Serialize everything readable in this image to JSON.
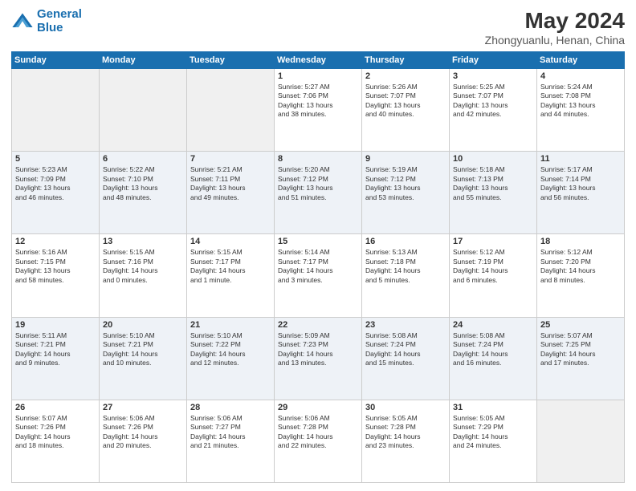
{
  "logo": {
    "line1": "General",
    "line2": "Blue"
  },
  "title": "May 2024",
  "subtitle": "Zhongyuanlu, Henan, China",
  "weekdays": [
    "Sunday",
    "Monday",
    "Tuesday",
    "Wednesday",
    "Thursday",
    "Friday",
    "Saturday"
  ],
  "weeks": [
    [
      {
        "day": "",
        "info": ""
      },
      {
        "day": "",
        "info": ""
      },
      {
        "day": "",
        "info": ""
      },
      {
        "day": "1",
        "info": "Sunrise: 5:27 AM\nSunset: 7:06 PM\nDaylight: 13 hours\nand 38 minutes."
      },
      {
        "day": "2",
        "info": "Sunrise: 5:26 AM\nSunset: 7:07 PM\nDaylight: 13 hours\nand 40 minutes."
      },
      {
        "day": "3",
        "info": "Sunrise: 5:25 AM\nSunset: 7:07 PM\nDaylight: 13 hours\nand 42 minutes."
      },
      {
        "day": "4",
        "info": "Sunrise: 5:24 AM\nSunset: 7:08 PM\nDaylight: 13 hours\nand 44 minutes."
      }
    ],
    [
      {
        "day": "5",
        "info": "Sunrise: 5:23 AM\nSunset: 7:09 PM\nDaylight: 13 hours\nand 46 minutes."
      },
      {
        "day": "6",
        "info": "Sunrise: 5:22 AM\nSunset: 7:10 PM\nDaylight: 13 hours\nand 48 minutes."
      },
      {
        "day": "7",
        "info": "Sunrise: 5:21 AM\nSunset: 7:11 PM\nDaylight: 13 hours\nand 49 minutes."
      },
      {
        "day": "8",
        "info": "Sunrise: 5:20 AM\nSunset: 7:12 PM\nDaylight: 13 hours\nand 51 minutes."
      },
      {
        "day": "9",
        "info": "Sunrise: 5:19 AM\nSunset: 7:12 PM\nDaylight: 13 hours\nand 53 minutes."
      },
      {
        "day": "10",
        "info": "Sunrise: 5:18 AM\nSunset: 7:13 PM\nDaylight: 13 hours\nand 55 minutes."
      },
      {
        "day": "11",
        "info": "Sunrise: 5:17 AM\nSunset: 7:14 PM\nDaylight: 13 hours\nand 56 minutes."
      }
    ],
    [
      {
        "day": "12",
        "info": "Sunrise: 5:16 AM\nSunset: 7:15 PM\nDaylight: 13 hours\nand 58 minutes."
      },
      {
        "day": "13",
        "info": "Sunrise: 5:15 AM\nSunset: 7:16 PM\nDaylight: 14 hours\nand 0 minutes."
      },
      {
        "day": "14",
        "info": "Sunrise: 5:15 AM\nSunset: 7:17 PM\nDaylight: 14 hours\nand 1 minute."
      },
      {
        "day": "15",
        "info": "Sunrise: 5:14 AM\nSunset: 7:17 PM\nDaylight: 14 hours\nand 3 minutes."
      },
      {
        "day": "16",
        "info": "Sunrise: 5:13 AM\nSunset: 7:18 PM\nDaylight: 14 hours\nand 5 minutes."
      },
      {
        "day": "17",
        "info": "Sunrise: 5:12 AM\nSunset: 7:19 PM\nDaylight: 14 hours\nand 6 minutes."
      },
      {
        "day": "18",
        "info": "Sunrise: 5:12 AM\nSunset: 7:20 PM\nDaylight: 14 hours\nand 8 minutes."
      }
    ],
    [
      {
        "day": "19",
        "info": "Sunrise: 5:11 AM\nSunset: 7:21 PM\nDaylight: 14 hours\nand 9 minutes."
      },
      {
        "day": "20",
        "info": "Sunrise: 5:10 AM\nSunset: 7:21 PM\nDaylight: 14 hours\nand 10 minutes."
      },
      {
        "day": "21",
        "info": "Sunrise: 5:10 AM\nSunset: 7:22 PM\nDaylight: 14 hours\nand 12 minutes."
      },
      {
        "day": "22",
        "info": "Sunrise: 5:09 AM\nSunset: 7:23 PM\nDaylight: 14 hours\nand 13 minutes."
      },
      {
        "day": "23",
        "info": "Sunrise: 5:08 AM\nSunset: 7:24 PM\nDaylight: 14 hours\nand 15 minutes."
      },
      {
        "day": "24",
        "info": "Sunrise: 5:08 AM\nSunset: 7:24 PM\nDaylight: 14 hours\nand 16 minutes."
      },
      {
        "day": "25",
        "info": "Sunrise: 5:07 AM\nSunset: 7:25 PM\nDaylight: 14 hours\nand 17 minutes."
      }
    ],
    [
      {
        "day": "26",
        "info": "Sunrise: 5:07 AM\nSunset: 7:26 PM\nDaylight: 14 hours\nand 18 minutes."
      },
      {
        "day": "27",
        "info": "Sunrise: 5:06 AM\nSunset: 7:26 PM\nDaylight: 14 hours\nand 20 minutes."
      },
      {
        "day": "28",
        "info": "Sunrise: 5:06 AM\nSunset: 7:27 PM\nDaylight: 14 hours\nand 21 minutes."
      },
      {
        "day": "29",
        "info": "Sunrise: 5:06 AM\nSunset: 7:28 PM\nDaylight: 14 hours\nand 22 minutes."
      },
      {
        "day": "30",
        "info": "Sunrise: 5:05 AM\nSunset: 7:28 PM\nDaylight: 14 hours\nand 23 minutes."
      },
      {
        "day": "31",
        "info": "Sunrise: 5:05 AM\nSunset: 7:29 PM\nDaylight: 14 hours\nand 24 minutes."
      },
      {
        "day": "",
        "info": ""
      }
    ]
  ]
}
